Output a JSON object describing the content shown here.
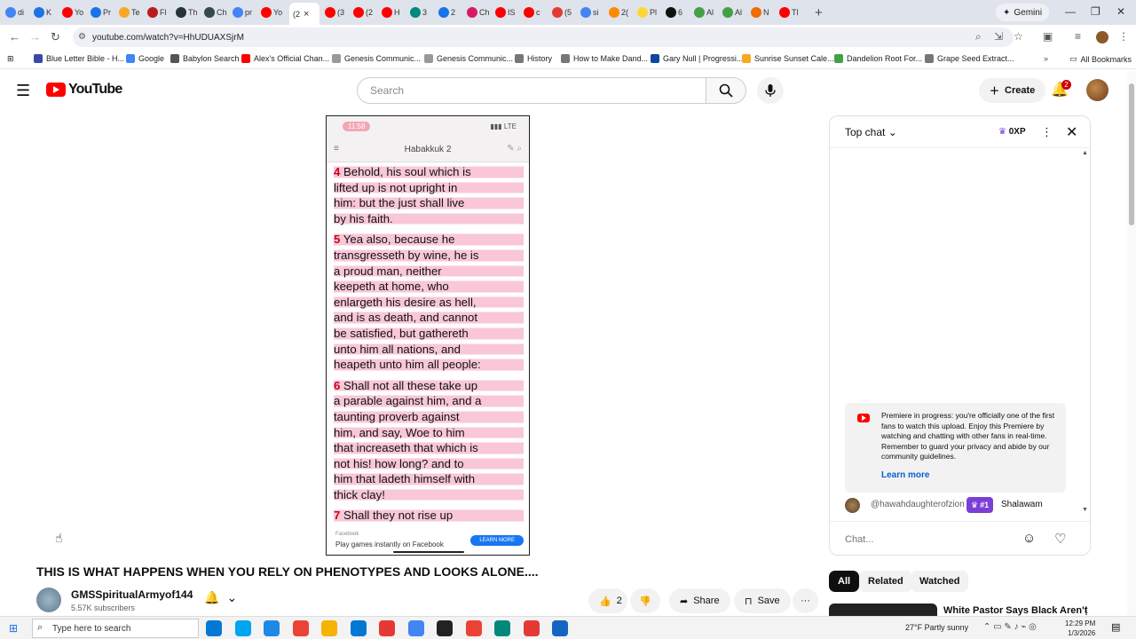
{
  "browser": {
    "tabs": [
      {
        "label": "di",
        "color": "#4285f4"
      },
      {
        "label": "K",
        "color": "#1a73e8"
      },
      {
        "label": "Yo",
        "color": "#ff0000"
      },
      {
        "label": "Pr",
        "color": "#1a73e8"
      },
      {
        "label": "Te",
        "color": "#f9a825"
      },
      {
        "label": "Fl",
        "color": "#b71c1c"
      },
      {
        "label": "Th",
        "color": "#263238"
      },
      {
        "label": "Ch",
        "color": "#37474f"
      },
      {
        "label": "pr",
        "color": "#4285f4"
      },
      {
        "label": "Yo",
        "color": "#ff0000"
      }
    ],
    "active_tab": {
      "label": "(2",
      "close": "×"
    },
    "tabs_right": [
      {
        "label": "(3",
        "color": "#ff0000"
      },
      {
        "label": "(2",
        "color": "#ff0000"
      },
      {
        "label": "H",
        "color": "#ff0000"
      },
      {
        "label": "3",
        "color": "#00897b"
      },
      {
        "label": "2",
        "color": "#1a73e8"
      },
      {
        "label": "Ch",
        "color": "#d81b60"
      },
      {
        "label": "IS",
        "color": "#ff0000"
      },
      {
        "label": "c",
        "color": "#ff0000"
      },
      {
        "label": "(5",
        "color": "#e53935"
      },
      {
        "label": "si",
        "color": "#4285f4"
      },
      {
        "label": "2(",
        "color": "#fb8c00"
      },
      {
        "label": "Pl",
        "color": "#fdd835"
      },
      {
        "label": "6",
        "color": "#111111"
      },
      {
        "label": "Al",
        "color": "#43a047"
      },
      {
        "label": "Al",
        "color": "#43a047"
      },
      {
        "label": "N",
        "color": "#ef6c00"
      },
      {
        "label": "Tl",
        "color": "#ff0000"
      }
    ],
    "new_tab": "+",
    "gemini_label": "Gemini",
    "url": "youtube.com/watch?v=HhUDUAXSjrM",
    "bookmarks": [
      {
        "label": "Blue Letter Bible - H...",
        "color": "#3949ab"
      },
      {
        "label": "Google",
        "color": "#4285f4"
      },
      {
        "label": "Babylon Search",
        "color": "#555555"
      },
      {
        "label": "Alex's Official Chan...",
        "color": "#ff0000"
      },
      {
        "label": "Genesis Communic...",
        "color": "#999999"
      },
      {
        "label": "Genesis Communic...",
        "color": "#999999"
      },
      {
        "label": "History",
        "color": "#777777"
      },
      {
        "label": "How to Make Dand...",
        "color": "#777777"
      },
      {
        "label": "Gary Null | Progressi...",
        "color": "#0d47a1"
      },
      {
        "label": "Sunrise Sunset Cale...",
        "color": "#f9a825"
      },
      {
        "label": "Dandelion Root For...",
        "color": "#43a047"
      },
      {
        "label": "Grape Seed Extract...",
        "color": "#777777"
      }
    ],
    "all_bookmarks": "All Bookmarks"
  },
  "youtube": {
    "brand": "YouTube",
    "search_placeholder": "Search",
    "create_label": "Create",
    "notification_count": "2"
  },
  "video": {
    "phone_time": "11:58",
    "phone_signal": "LTE",
    "chapter": "Habakkuk 2",
    "verses": [
      {
        "num": "4",
        "lines": [
          "Behold, his soul which is",
          "lifted up is not upright in",
          "him: but the just shall live",
          "by his faith."
        ]
      },
      {
        "num": "5",
        "lines": [
          "Yea also, because he",
          "transgresseth by wine, he is",
          "a proud man, neither",
          "keepeth at home, who",
          "enlargeth his desire as hell,",
          "and is as death, and cannot",
          "be satisfied, but gathereth",
          "unto him all nations, and",
          "heapeth unto him all people:"
        ]
      },
      {
        "num": "6",
        "lines": [
          "Shall not all these take up",
          "a parable against him, and a",
          "taunting proverb against",
          "him, and say, Woe to him",
          "that increaseth that which is",
          "not his! how long? and to",
          "him that ladeth himself with",
          "thick clay!"
        ]
      },
      {
        "num": "7",
        "lines": [
          "Shall they not rise up"
        ]
      }
    ],
    "ad_label": "Facebook",
    "ad_text": "Play games instantly on Facebook",
    "ad_button": "LEARN MORE",
    "title": "THIS IS WHAT HAPPENS WHEN YOU RELY ON PHENOTYPES AND LOOKS ALONE....",
    "channel": "GMSSpiritualArmyof144",
    "subscribers": "5.57K subscribers",
    "likes": "2",
    "share_label": "Share",
    "save_label": "Save"
  },
  "chat": {
    "mode": "Top chat",
    "xp": "0XP",
    "premiere_text": "Premiere in progress: you're officially one of the first fans to watch this upload. Enjoy this Premiere by watching and chatting with other fans in real-time. Remember to guard your privacy and abide by our community guidelines.",
    "learn_more": "Learn more",
    "message": {
      "author": "@hawahdaughterofzion",
      "badge": "#1",
      "text": "Shalawam"
    },
    "input_placeholder": "Chat..."
  },
  "related": {
    "chips": [
      "All",
      "Related",
      "Watched"
    ],
    "first_title": "White Pastor Says Black Aren't"
  },
  "taskbar": {
    "search_placeholder": "Type here to search",
    "weather": "27°F  Partly sunny",
    "time": "12:29 PM",
    "date": "1/3/2026",
    "icons": [
      "#0078d4",
      "#00a4ef",
      "#1e88e5",
      "#ea4335",
      "#f4b400",
      "#0078d4",
      "#e53935",
      "#4285f4",
      "#222222",
      "#ea4335",
      "#00897b",
      "#e53935",
      "#1565c0"
    ]
  }
}
